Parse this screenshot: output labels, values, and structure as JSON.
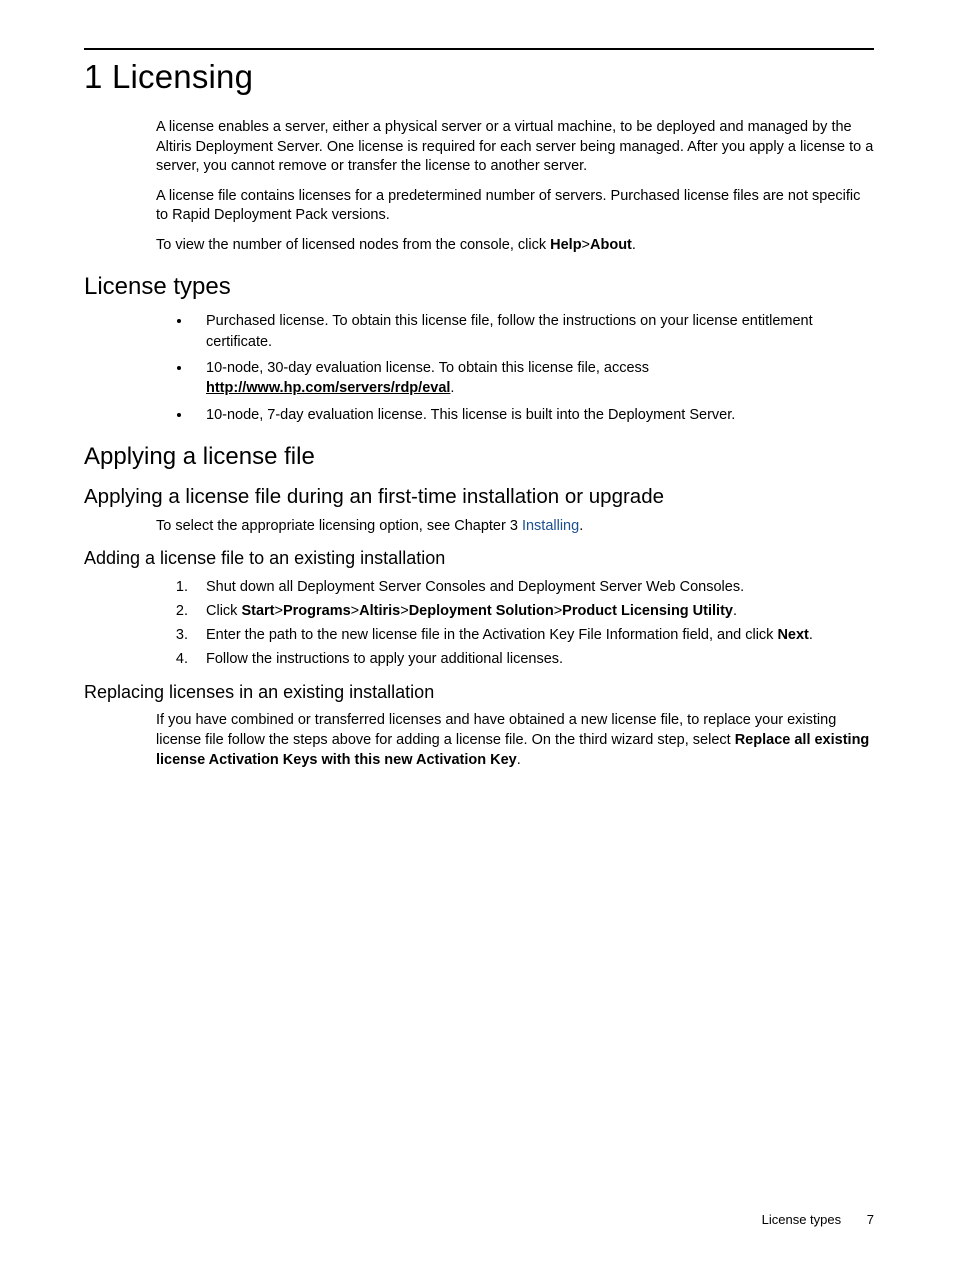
{
  "chapter": {
    "number": "1",
    "title": "Licensing"
  },
  "intro": {
    "p1": "A license enables a server, either a physical server or a virtual machine, to be deployed and managed by the Altiris Deployment Server. One license is required for each server being managed. After you apply a license to a server, you cannot remove or transfer the license to another server.",
    "p2": "A license file contains licenses for a predetermined number of servers. Purchased license files are not specific to Rapid Deployment Pack versions.",
    "p3_pre": "To view the number of licensed nodes from the console, click ",
    "p3_help": "Help",
    "p3_gt": ">",
    "p3_about": "About",
    "p3_post": "."
  },
  "license_types": {
    "heading": "License types",
    "item1": "Purchased license. To obtain this license file, follow the instructions on your license entitlement certificate.",
    "item2_pre": "10-node, 30-day evaluation license. To obtain this license file, access ",
    "item2_link": "http://www.hp.com/servers/rdp/eval",
    "item2_post": ".",
    "item3": "10-node, 7-day evaluation license. This license is built into the Deployment Server."
  },
  "applying": {
    "heading": "Applying a license file",
    "first_time": {
      "heading": "Applying a license file during an first-time installation or upgrade",
      "p_pre": "To select the appropriate licensing option, see Chapter 3 ",
      "p_link": "Installing",
      "p_post": "."
    },
    "adding": {
      "heading": "Adding a license file to an existing installation",
      "s1": "Shut down all Deployment Server Consoles and Deployment Server Web Consoles.",
      "s2_pre": "Click ",
      "s2_start": "Start",
      "s2_gt": ">",
      "s2_programs": "Programs",
      "s2_altiris": "Altiris",
      "s2_ds": "Deployment Solution",
      "s2_plu": "Product Licensing Utility",
      "s2_post": ".",
      "s3_pre": "Enter the path to the new license file in the Activation Key File Information field, and click ",
      "s3_next": "Next",
      "s3_post": ".",
      "s4": "Follow the instructions to apply your additional licenses."
    },
    "replacing": {
      "heading": "Replacing licenses in an existing installation",
      "p_pre": "If you have combined or transferred licenses and have obtained a new license file, to replace your existing license file follow the steps above for adding a license file. On the third wizard step, select ",
      "p_bold": "Replace all existing license Activation Keys with this new Activation Key",
      "p_post": "."
    }
  },
  "footer": {
    "section": "License types",
    "page": "7"
  }
}
